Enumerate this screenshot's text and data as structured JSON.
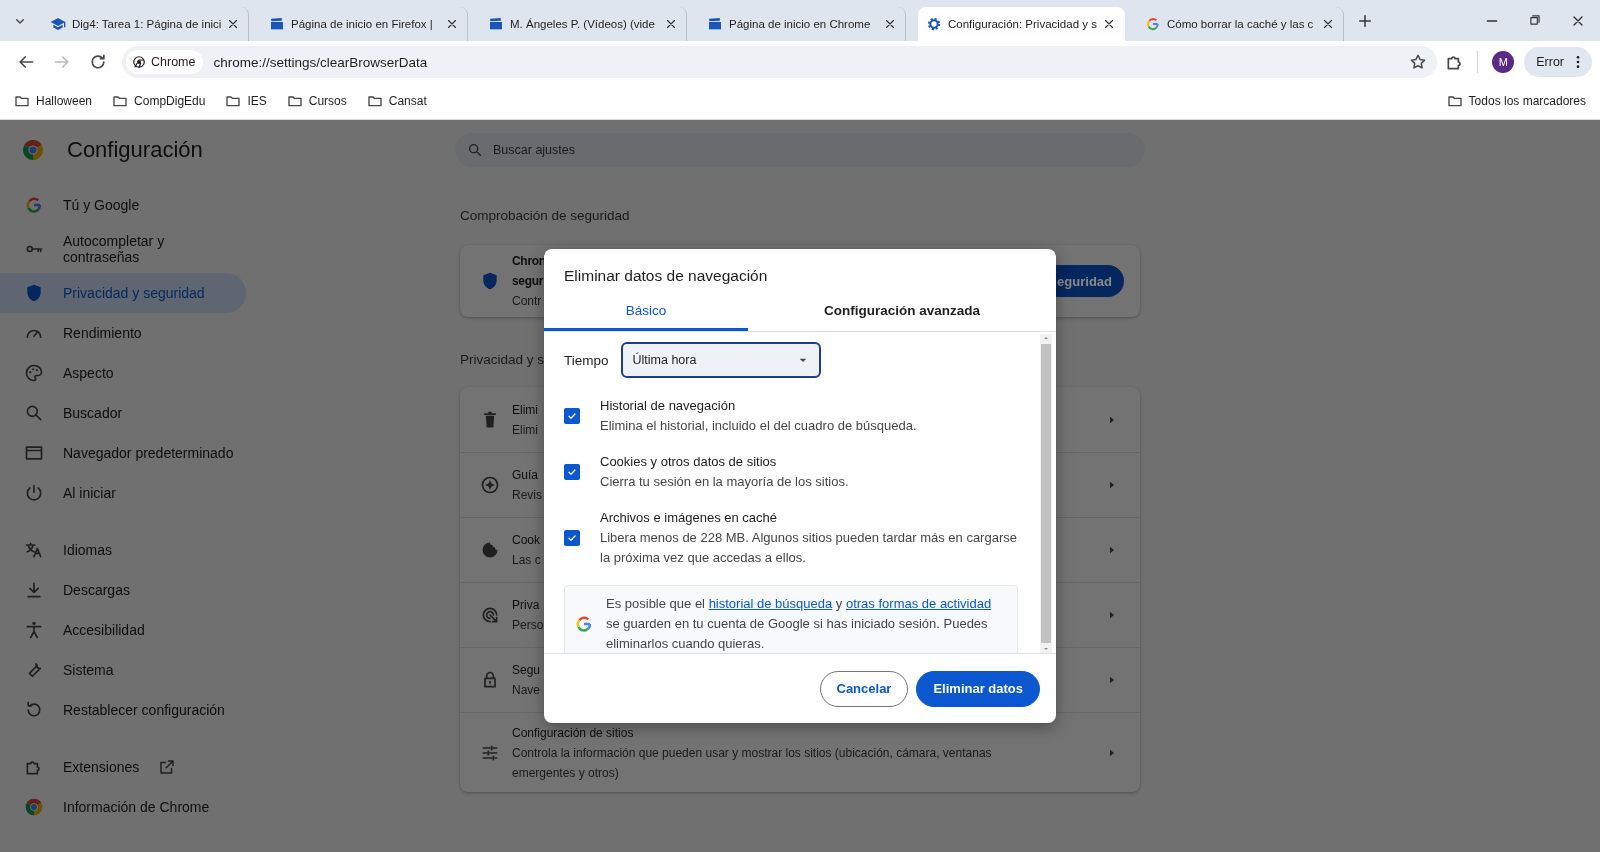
{
  "browser": {
    "tabs": [
      {
        "title": "Dig4: Tarea 1: Página de inici",
        "selected": false
      },
      {
        "title": "Página de inicio en Firefox |",
        "selected": false
      },
      {
        "title": "M. Ángeles P. (Vídeos) (vide",
        "selected": false
      },
      {
        "title": "Página de inicio en Chrome",
        "selected": false
      },
      {
        "title": "Configuración: Privacidad y s",
        "selected": true
      },
      {
        "title": "Cómo borrar la caché y las c",
        "selected": false
      }
    ],
    "site_chip": "Chrome",
    "url": "chrome://settings/clearBrowserData",
    "profile_initial": "M",
    "error_button": "Error",
    "bookmarks": [
      "Halloween",
      "CompDigEdu",
      "IES",
      "Cursos",
      "Cansat"
    ],
    "all_bookmarks": "Todos los marcadores"
  },
  "settings": {
    "title": "Configuración",
    "search_placeholder": "Buscar ajustes",
    "nav_groups": [
      {
        "items": [
          {
            "label": "Tú y Google",
            "selected": false,
            "external_link": false
          },
          {
            "label": "Autocompletar y contraseñas",
            "selected": false,
            "external_link": false
          },
          {
            "label": "Privacidad y seguridad",
            "selected": true,
            "external_link": false
          },
          {
            "label": "Rendimiento",
            "selected": false,
            "external_link": false
          },
          {
            "label": "Aspecto",
            "selected": false,
            "external_link": false
          },
          {
            "label": "Buscador",
            "selected": false,
            "external_link": false
          },
          {
            "label": "Navegador predeterminado",
            "selected": false,
            "external_link": false
          },
          {
            "label": "Al iniciar",
            "selected": false,
            "external_link": false
          }
        ]
      },
      {
        "items": [
          {
            "label": "Idiomas",
            "selected": false,
            "external_link": false
          },
          {
            "label": "Descargas",
            "selected": false,
            "external_link": false
          },
          {
            "label": "Accesibilidad",
            "selected": false,
            "external_link": false
          },
          {
            "label": "Sistema",
            "selected": false,
            "external_link": false
          },
          {
            "label": "Restablecer configuración",
            "selected": false,
            "external_link": false
          }
        ]
      },
      {
        "items": [
          {
            "label": "Extensiones",
            "selected": false,
            "external_link": true
          },
          {
            "label": "Información de Chrome",
            "selected": false,
            "external_link": false
          }
        ]
      }
    ],
    "safety_heading": "Comprobación de seguridad",
    "safety_card": {
      "title_lines": [
        "Chron",
        "segur"
      ],
      "subtitle": "Contr",
      "button": "eguridad"
    },
    "privacy_heading": "Privacidad y s",
    "privacy_rows": [
      {
        "title": "Elimi",
        "subtitle": "Elimi"
      },
      {
        "title": "Guía",
        "subtitle": "Revis"
      },
      {
        "title": "Cook",
        "subtitle": "Las c"
      },
      {
        "title": "Priva",
        "subtitle": "Perso"
      },
      {
        "title": "Segu",
        "subtitle": "Nave"
      },
      {
        "title": "Configuración de sitios",
        "subtitle": "Controla la información que pueden usar y mostrar los sitios (ubicación, cámara, ventanas emergentes y otros)"
      }
    ]
  },
  "dialog": {
    "title": "Eliminar datos de navegación",
    "tabs": [
      {
        "label": "Básico",
        "selected": true
      },
      {
        "label": "Configuración avanzada",
        "selected": false
      }
    ],
    "time_label": "Tiempo",
    "time_value": "Última hora",
    "options": [
      {
        "title": "Historial de navegación",
        "description": "Elimina el historial, incluido el del cuadro de búsqueda.",
        "checked": true
      },
      {
        "title": "Cookies y otros datos de sitios",
        "description": "Cierra tu sesión en la mayoría de los sitios.",
        "checked": true
      },
      {
        "title": "Archivos e imágenes en caché",
        "description": "Libera menos de 228 MB. Algunos sitios pueden tardar más en cargarse la próxima vez que accedas a ellos.",
        "checked": true
      }
    ],
    "notice": [
      {
        "kind": "text",
        "text": "Es posible que el "
      },
      {
        "kind": "link",
        "text": "historial de búsqueda"
      },
      {
        "kind": "text",
        "text": " y "
      },
      {
        "kind": "link",
        "text": "otras formas de actividad"
      },
      {
        "kind": "text",
        "text": " se guarden en tu cuenta de Google si has iniciado sesión. Puedes eliminarlos cuando quieras."
      }
    ],
    "buttons": [
      {
        "label": "Cancelar",
        "kind": "secondary"
      },
      {
        "label": "Eliminar datos",
        "kind": "primary"
      }
    ]
  }
}
